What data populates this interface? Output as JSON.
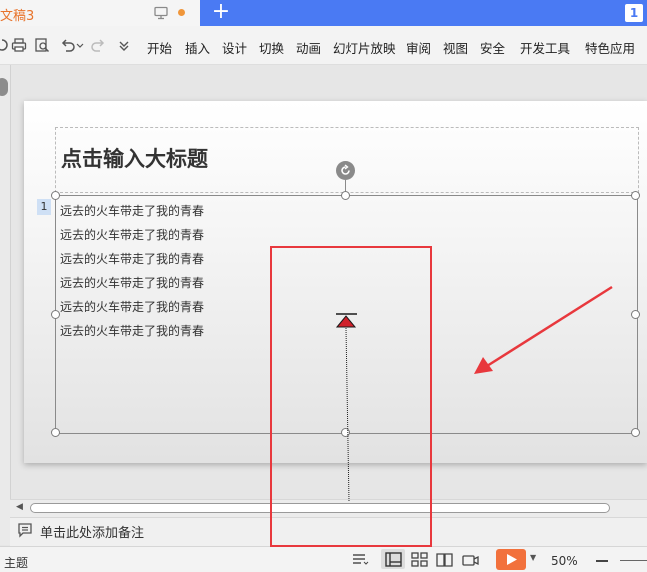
{
  "titlebar": {
    "doc_tab": "文稿3",
    "window_badge": "1",
    "new_tab": "+"
  },
  "toolbar": {
    "menu": [
      "开始",
      "插入",
      "设计",
      "切换",
      "动画",
      "幻灯片放映",
      "审阅",
      "视图",
      "安全",
      "开发工具",
      "特色应用"
    ]
  },
  "slide": {
    "title": "点击输入大标题",
    "paragraph_number": "1",
    "body_lines": [
      "远去的火车带走了我的青春",
      "远去的火车带走了我的青春",
      "远去的火车带走了我的青春",
      "远去的火车带走了我的青春",
      "远去的火车带走了我的青春",
      "远去的火车带走了我的青春"
    ]
  },
  "notes": {
    "placeholder": "单击此处添加备注"
  },
  "statusbar": {
    "theme": "主题",
    "zoom": "50%"
  },
  "colors": {
    "titlebar": "#4a7af3",
    "tab_text": "#e8742c",
    "play_button": "#f2713c",
    "annotation_red": "#e8383d",
    "marker_red": "#d0202a"
  }
}
